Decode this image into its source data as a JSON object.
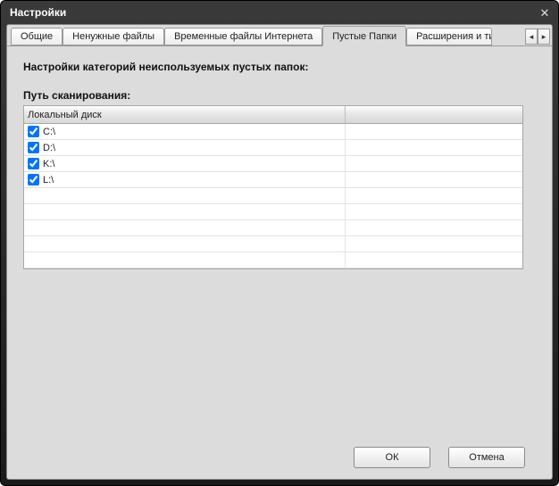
{
  "window": {
    "title": "Настройки"
  },
  "tabs": [
    {
      "label": "Общие",
      "active": false
    },
    {
      "label": "Ненужные файлы",
      "active": false
    },
    {
      "label": "Временные файлы Интернета",
      "active": false
    },
    {
      "label": "Пустые Папки",
      "active": true
    },
    {
      "label": "Расширения и типы",
      "active": false,
      "partial": true
    }
  ],
  "section": {
    "title": "Настройки категорий неиспользуемых пустых папок:",
    "scan_path_label": "Путь сканирования:"
  },
  "grid": {
    "columns": [
      {
        "label": "Локальный диск"
      },
      {
        "label": ""
      }
    ],
    "rows": [
      {
        "checked": true,
        "path": "C:\\"
      },
      {
        "checked": true,
        "path": "D:\\"
      },
      {
        "checked": true,
        "path": "K:\\"
      },
      {
        "checked": true,
        "path": "L:\\"
      }
    ],
    "empty_rows": 5
  },
  "buttons": {
    "ok": "ОК",
    "cancel": "Отмена"
  }
}
